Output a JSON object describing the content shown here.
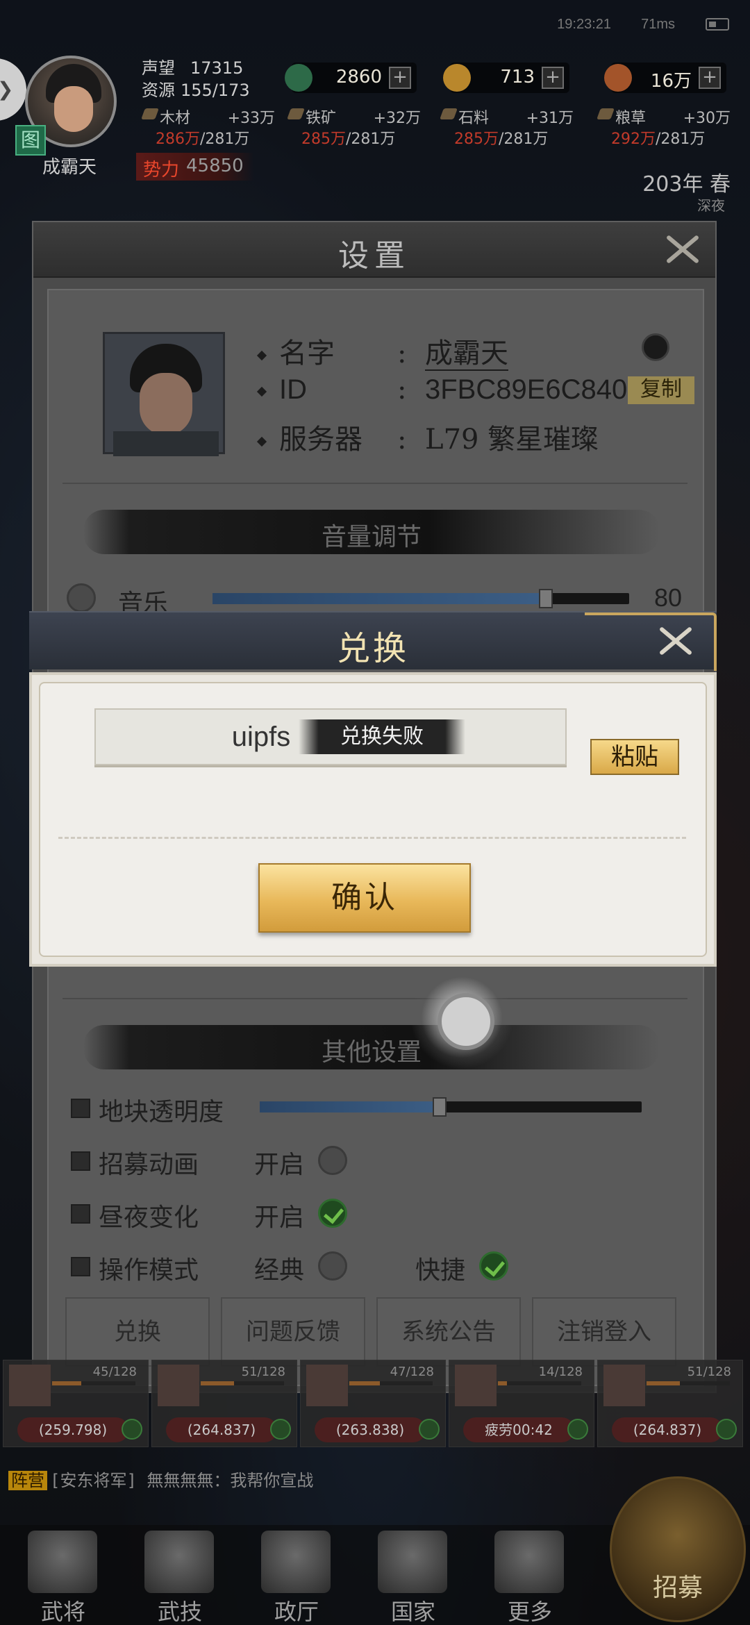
{
  "status_bar": {
    "time": "19:23:21",
    "ping": "71ms"
  },
  "hud": {
    "player_name": "成霸天",
    "seal_glyph": "图",
    "fame_label": "声望",
    "fame_value": "17315",
    "resource_label": "资源",
    "resource_value": "155/173",
    "currencies": [
      {
        "icon": "troops-icon",
        "value": "2860"
      },
      {
        "icon": "copper-coin-icon",
        "value": "713"
      },
      {
        "icon": "gold-coin-icon",
        "value": "16万"
      }
    ],
    "materials": [
      {
        "name": "木材",
        "gain": "+33万",
        "current": "286万",
        "cap": "/281万"
      },
      {
        "name": "铁矿",
        "gain": "+32万",
        "current": "285万",
        "cap": "/281万"
      },
      {
        "name": "石料",
        "gain": "+31万",
        "current": "285万",
        "cap": "/281万"
      },
      {
        "name": "粮草",
        "gain": "+30万",
        "current": "292万",
        "cap": "/281万"
      }
    ],
    "power_label": "势力",
    "power_value": "45850",
    "season": "203年 春",
    "season_sub": "深夜"
  },
  "settings": {
    "title": "设置",
    "name_key": "名字",
    "name_value": "成霸天",
    "id_key": "ID",
    "id_value": "3FBC89E6C840",
    "server_key": "服务器",
    "server_value": "L79 繁星璀璨",
    "colon": ":",
    "copy_label": "复制",
    "volume_section": "音量调节",
    "music_label": "音乐",
    "music_value": "80",
    "music_level": 0.8,
    "other_section": "其他设置",
    "tile_opacity_label": "地块透明度",
    "tile_opacity_level": 0.47,
    "recruit_anim_label": "招募动画",
    "recruit_anim_option": "开启",
    "day_night_label": "昼夜变化",
    "day_night_option": "开启",
    "op_mode_label": "操作模式",
    "op_mode_classic": "经典",
    "op_mode_fast": "快捷",
    "tabs": [
      "兑换",
      "问题反馈",
      "系统公告",
      "注销登入"
    ]
  },
  "redeem": {
    "title": "兑换",
    "code_text": "uipfs",
    "toast": "兑换失败",
    "paste_label": "粘贴",
    "confirm_label": "确认"
  },
  "generals": [
    {
      "stat": "45/128",
      "coord": "(259.798)"
    },
    {
      "stat": "51/128",
      "coord": "(264.837)"
    },
    {
      "stat": "47/128",
      "coord": "(263.838)"
    },
    {
      "stat": "14/128",
      "coord": "疲劳00:42"
    },
    {
      "stat": "51/128",
      "coord": "(264.837)"
    }
  ],
  "chat": {
    "tag": "阵营",
    "text": "[安东将军] 無無無無：我帮你宣战"
  },
  "nav": [
    "武将",
    "武技",
    "政厅",
    "国家",
    "更多"
  ],
  "recruit_label": "招募"
}
